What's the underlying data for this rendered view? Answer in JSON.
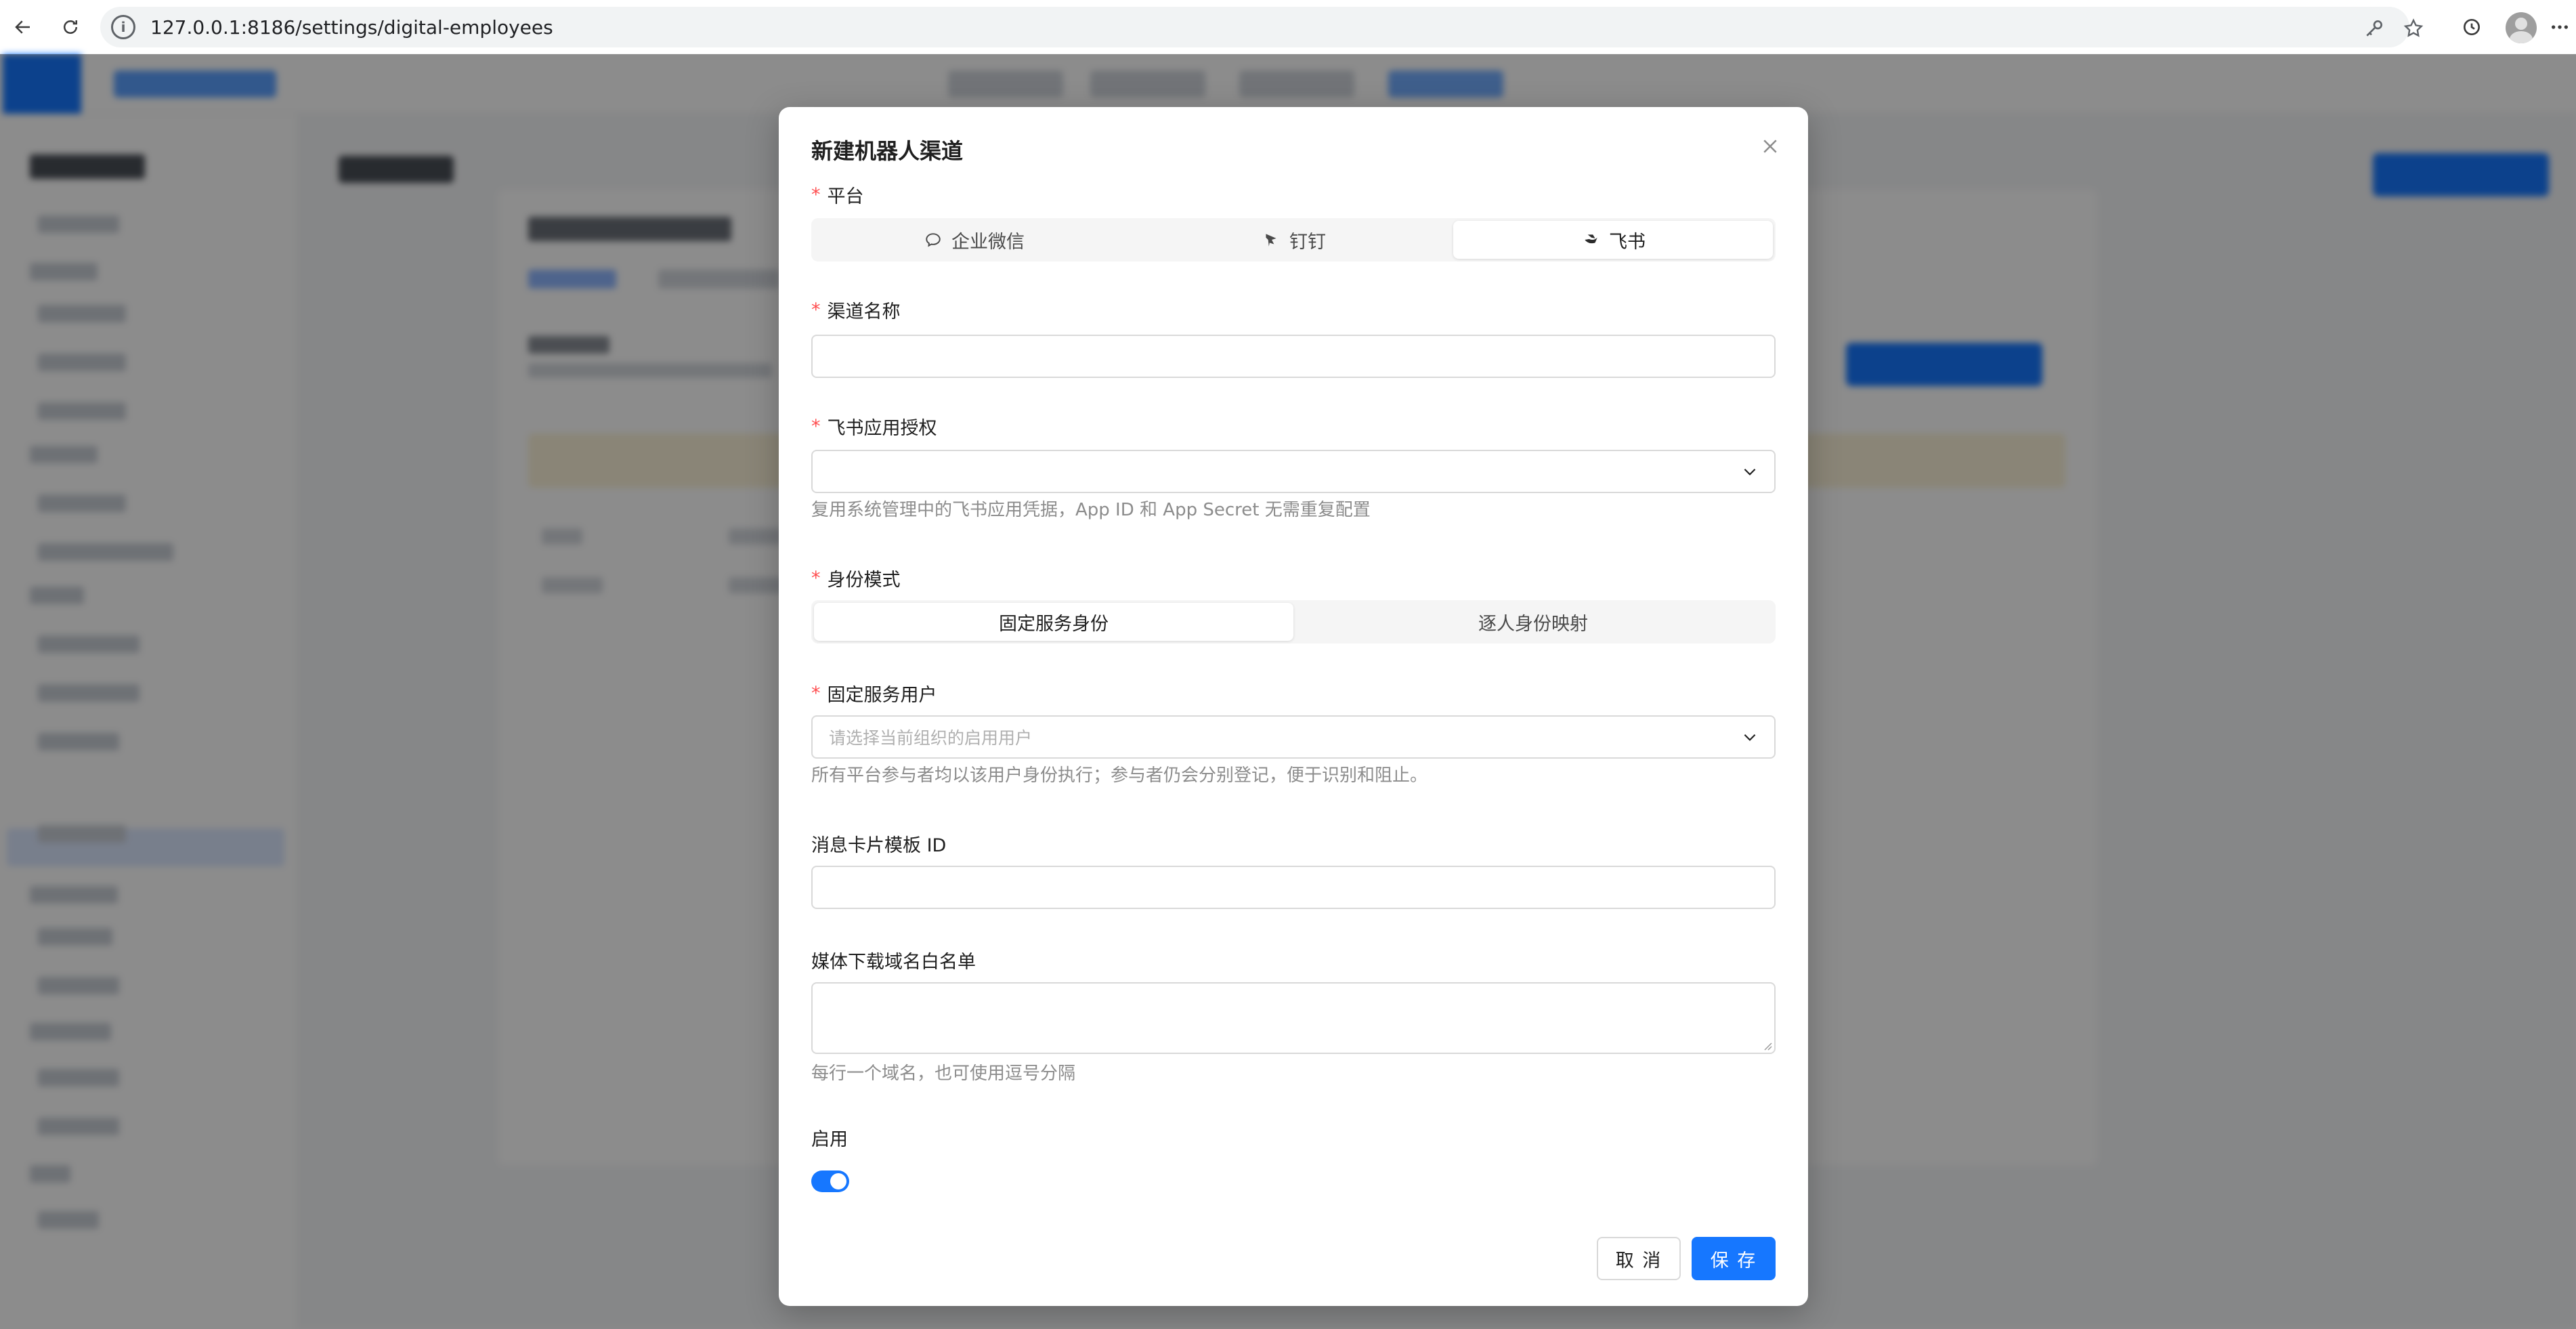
{
  "browser": {
    "url": "127.0.0.1:8186/settings/digital-employees"
  },
  "modal": {
    "title": "新建机器人渠道",
    "platform": {
      "label": "平台",
      "options": [
        {
          "label": "企业微信",
          "icon": "wecom-icon",
          "selected": false
        },
        {
          "label": "钉钉",
          "icon": "dingtalk-icon",
          "selected": false
        },
        {
          "label": "飞书",
          "icon": "feishu-icon",
          "selected": true
        }
      ]
    },
    "channel_name": {
      "label": "渠道名称",
      "value": ""
    },
    "app_auth": {
      "label": "飞书应用授权",
      "value": "",
      "help": "复用系统管理中的飞书应用凭据，App ID 和 App Secret 无需重复配置"
    },
    "identity_mode": {
      "label": "身份模式",
      "options": [
        {
          "label": "固定服务身份",
          "selected": true
        },
        {
          "label": "逐人身份映射",
          "selected": false
        }
      ]
    },
    "service_user": {
      "label": "固定服务用户",
      "placeholder": "请选择当前组织的启用用户",
      "help": "所有平台参与者均以该用户身份执行；参与者仍会分别登记，便于识别和阻止。"
    },
    "card_template": {
      "label": "消息卡片模板 ID",
      "value": ""
    },
    "media_whitelist": {
      "label": "媒体下载域名白名单",
      "value": "",
      "help": "每行一个域名，也可使用逗号分隔"
    },
    "enabled": {
      "label": "启用",
      "value": true
    },
    "cancel_label": "取 消",
    "save_label": "保 存"
  },
  "colors": {
    "primary": "#1677ff",
    "required": "#ff4d4f",
    "help_text": "#8c8c8c"
  }
}
